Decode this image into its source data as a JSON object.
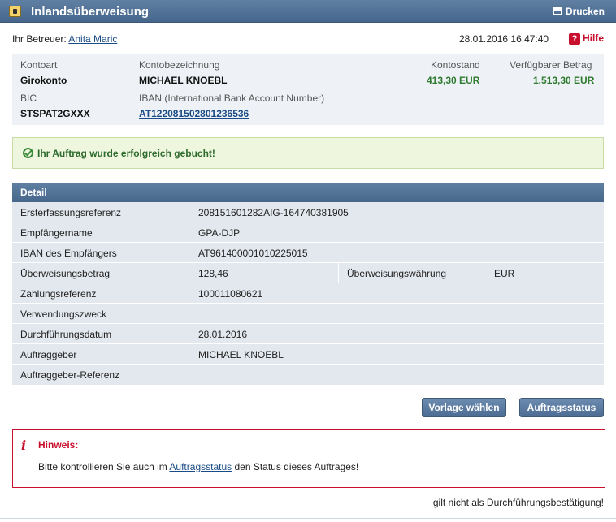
{
  "header": {
    "title": "Inlandsüberweisung",
    "print_label": "Drucken",
    "title_icon": "calendar-icon",
    "print_icon": "printer-icon"
  },
  "info": {
    "betreuer_label": "Ihr Betreuer:",
    "betreuer_name": "Anita Maric",
    "datetime": "28.01.2016 16:47:40",
    "help_label": "Hilfe",
    "help_icon": "question-icon"
  },
  "account": {
    "kontoart_label": "Kontoart",
    "kontoart": "Girokonto",
    "bezeichnung_label": "Kontobezeichnung",
    "bezeichnung": "MICHAEL KNOEBL",
    "kontostand_label": "Kontostand",
    "kontostand": "413,30 EUR",
    "verfuegbar_label": "Verfügbarer Betrag",
    "verfuegbar": "1.513,30 EUR",
    "bic_label": "BIC",
    "bic": "STSPAT2GXXX",
    "iban_label": "IBAN (International Bank Account Number)",
    "iban": "AT122081502801236536"
  },
  "success": {
    "message": "Ihr Auftrag wurde erfolgreich gebucht!",
    "icon": "checkmark-circle-icon"
  },
  "detail": {
    "title": "Detail",
    "rows": [
      {
        "key": "Ersterfassungsreferenz",
        "value": "208151601282AIG-164740381905"
      },
      {
        "key": "Empfängername",
        "value": "GPA-DJP"
      },
      {
        "key": "IBAN des Empfängers",
        "value": "AT961400001010225015"
      },
      {
        "key": "Überweisungsbetrag",
        "value": "128,46",
        "key2": "Überweisungswährung",
        "value2": "EUR"
      },
      {
        "key": "Zahlungsreferenz",
        "value": "100011080621"
      },
      {
        "key": "Verwendungszweck",
        "value": ""
      },
      {
        "key": "Durchführungsdatum",
        "value": "28.01.2016"
      },
      {
        "key": "Auftraggeber",
        "value": "MICHAEL KNOEBL"
      },
      {
        "key": "Auftraggeber-Referenz",
        "value": ""
      }
    ]
  },
  "buttons": {
    "vorlage": "Vorlage wählen",
    "status": "Auftragsstatus"
  },
  "hinweis": {
    "title": "Hinweis:",
    "text_before": "Bitte kontrollieren Sie auch im ",
    "link": "Auftragsstatus",
    "text_after": " den Status dieses Auftrages!",
    "icon": "info-icon"
  },
  "footer": {
    "note": "gilt nicht als Durchführungsbestätigung!"
  },
  "colors": {
    "header_blue": "#4f6f95",
    "success_green": "#2e6a2e",
    "alert_red": "#c8102e",
    "link_blue": "#1a4b86"
  }
}
